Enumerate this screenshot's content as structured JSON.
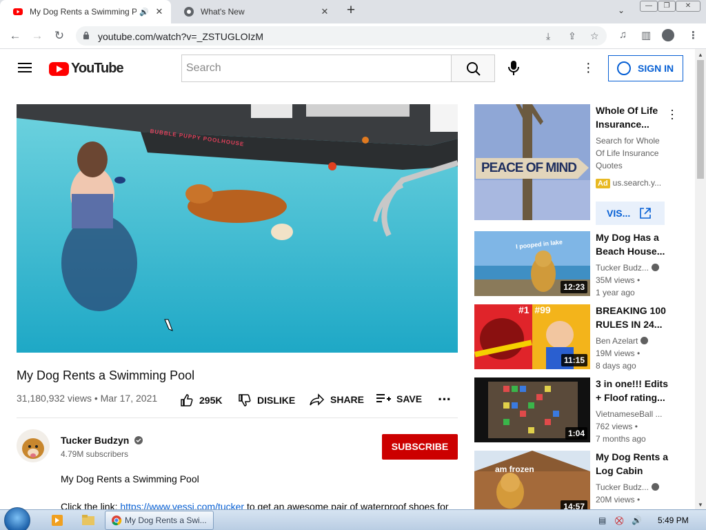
{
  "browser": {
    "tabs": [
      {
        "title": "My Dog Rents a Swimming P",
        "active": true,
        "audio": true
      },
      {
        "title": "What's New",
        "active": false
      }
    ],
    "url": "youtube.com/watch?v=_ZSTUGLOIzM"
  },
  "youtube": {
    "logo_text": "YouTube",
    "search_placeholder": "Search",
    "sign_in": "SIGN IN",
    "video": {
      "title": "My Dog Rents a Swimming Pool",
      "meta": "31,180,932 views • Mar 17, 2021",
      "like_count": "295K",
      "dislike": "DISLIKE",
      "share": "SHARE",
      "save": "SAVE",
      "pool_sign": "BUBBLE PUPPY POOLHOUSE"
    },
    "channel": {
      "name": "Tucker Budzyn",
      "subscribers": "4.79M subscribers",
      "subscribe": "SUBSCRIBE"
    },
    "description": {
      "line1": "My Dog Rents a  Swimming Pool",
      "line2_prefix": "Click the link: ",
      "link": "https://www.vessi.com/tucker",
      "line2_suffix": " to get an awesome pair of waterproof shoes for"
    },
    "ad": {
      "thumb_text": "PEACE OF MIND",
      "title": "Whole Of Life Insurance...",
      "desc": [
        "Search for Whole",
        "Of Life Insurance",
        "Quotes"
      ],
      "badge": "Ad",
      "domain": "us.search.y...",
      "visit": "VIS..."
    },
    "recommendations": [
      {
        "title1": "My Dog Has a",
        "title2": "Beach House...",
        "channel": "Tucker Budz...",
        "views": "35M views •",
        "age": "1 year ago",
        "duration": "12:23",
        "overlay": "I pooped in lake"
      },
      {
        "title1": "BREAKING 100",
        "title2": "RULES IN 24...",
        "channel": "Ben Azelart",
        "views": "19M views •",
        "age": "8 days ago",
        "duration": "11:15",
        "overlay": "#1  #99"
      },
      {
        "title1": "3 in one!!! Edits",
        "title2": "+ Floof rating...",
        "channel": "VietnameseBall ...",
        "views": "762 views •",
        "age": "7 months ago",
        "duration": "1:04",
        "overlay": ""
      },
      {
        "title1": "My Dog Rents a",
        "title2": "Log Cabin",
        "channel": "Tucker Budz...",
        "views": "20M views •",
        "age": "",
        "duration": "14:57",
        "overlay": "am frozen"
      }
    ]
  },
  "taskbar": {
    "chrome_label": "My Dog Rents a Swi...",
    "clock": "5:49 PM"
  }
}
